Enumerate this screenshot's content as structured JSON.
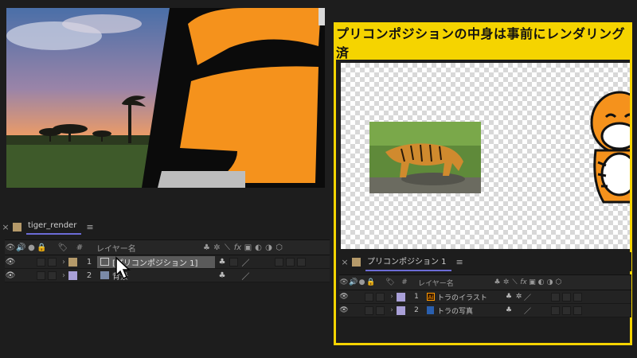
{
  "left_panel": {
    "comp_tab": {
      "close": "×",
      "title": "tiger_render",
      "menu": "≡",
      "swatch_color": "#b59a6a"
    },
    "header": {
      "number_col": "#",
      "name_col": "レイヤー名"
    },
    "layers": [
      {
        "number": "1",
        "name": "[プリコンポジション 1]",
        "swatch_color": "#b59a6a",
        "selected": true
      },
      {
        "number": "2",
        "name": "背景",
        "swatch_color": "#a9a0d8",
        "selected": false
      }
    ]
  },
  "callout": {
    "title": "プリコンポジションの中身は事前にレンダリング済",
    "border_color": "#f5d400"
  },
  "right_panel": {
    "comp_tab": {
      "close": "×",
      "title": "プリコンポジション 1",
      "menu": "≡",
      "swatch_color": "#b59a6a"
    },
    "header": {
      "number_col": "#",
      "name_col": "レイヤー名"
    },
    "layers": [
      {
        "number": "1",
        "name": "トラのイラスト",
        "type_icon": "Ai",
        "swatch_color": "#a9a0d8"
      },
      {
        "number": "2",
        "name": "トラの写真",
        "type_icon": "image",
        "swatch_color": "#a9a0d8"
      }
    ]
  }
}
